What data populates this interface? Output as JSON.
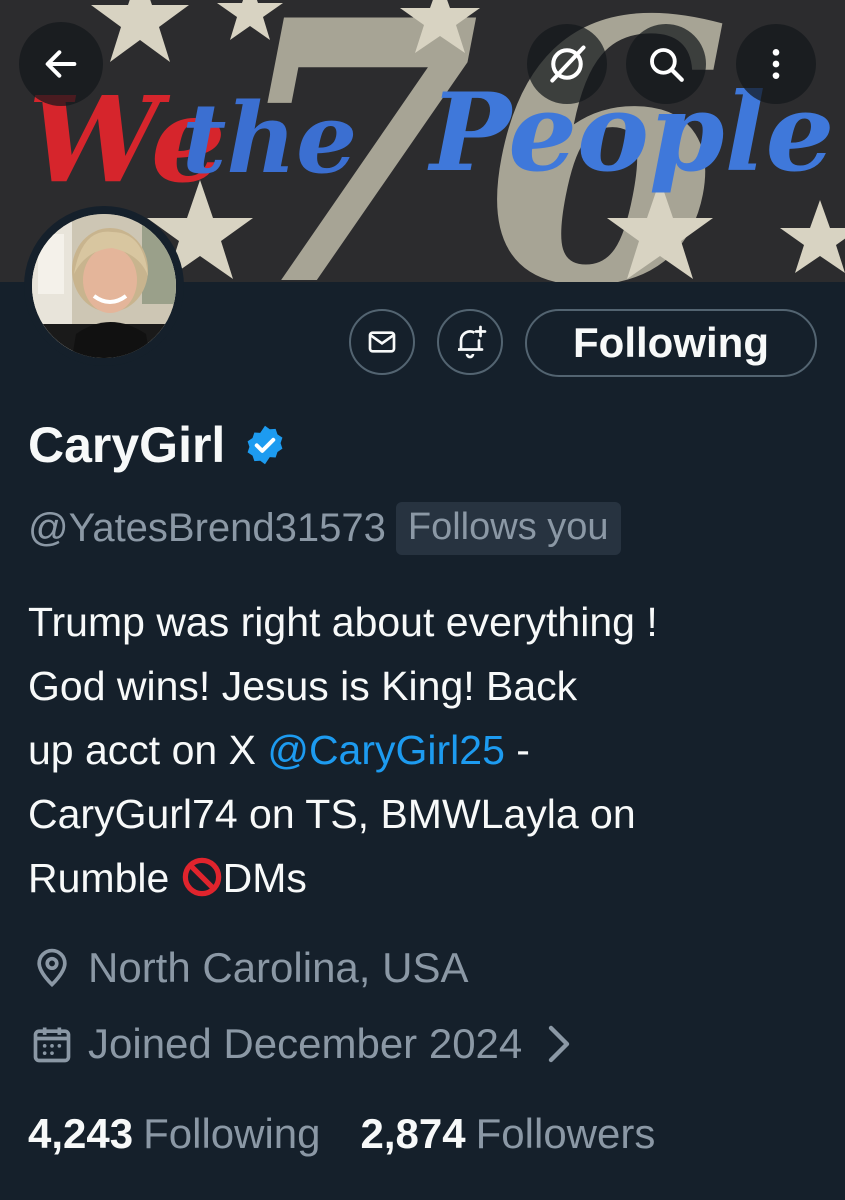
{
  "banner": {
    "text_we": "We",
    "text_the": "the",
    "text_people": "People",
    "big_number": "76"
  },
  "profile": {
    "display_name": "CaryGirl",
    "handle": "@YatesBrend31573",
    "follows_you": "Follows you",
    "bio": {
      "line1": "Trump was right about everything !",
      "line2": "God wins! Jesus is King! Back",
      "line3_prefix": "up acct on X ",
      "line3_mention": "@CaryGirl25",
      "line3_suffix": " -",
      "line4": "CaryGurl74 on TS, BMWLayla on",
      "line5_prefix": "Rumble ",
      "line5_suffix": "DMs"
    },
    "location": "North Carolina, USA",
    "joined": "Joined December 2024",
    "following_count": "4,243",
    "following_label": "Following",
    "followers_count": "2,874",
    "followers_label": "Followers"
  },
  "actions": {
    "follow_button_label": "Following"
  },
  "icons": {
    "back": "arrow-left-icon",
    "grok": "grok-icon",
    "search": "search-icon",
    "more": "more-vertical-icon",
    "message": "envelope-icon",
    "notify": "bell-plus-icon",
    "verified": "verified-badge-icon",
    "location": "location-pin-icon",
    "calendar": "calendar-icon",
    "no_entry": "no-entry-sign-icon"
  },
  "colors": {
    "background": "#15202b",
    "accent": "#1d9bf0",
    "muted": "#8b98a5",
    "border": "#536471"
  }
}
